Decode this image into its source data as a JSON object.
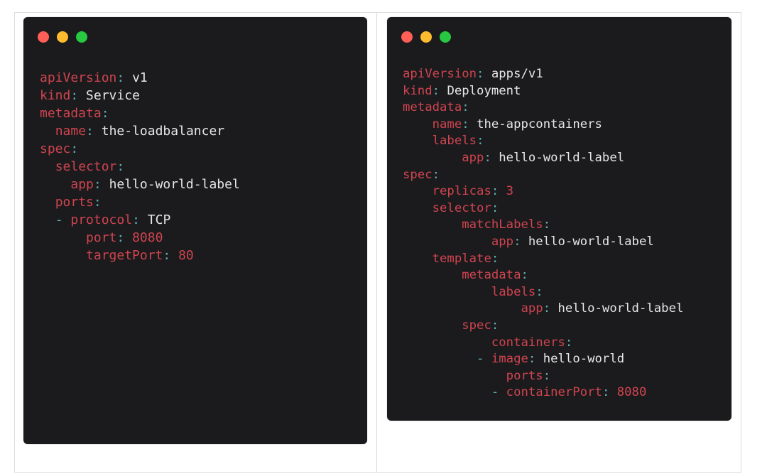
{
  "colors": {
    "key": "#cf4450",
    "punct": "#5fb3b3",
    "num": "#cf4450",
    "value": "#e6e6e6",
    "background": "#1b1b1d",
    "dot_red": "#ff5f57",
    "dot_yellow": "#febc2e",
    "dot_green": "#28c840"
  },
  "window_controls": [
    "close-dot",
    "minimize-dot",
    "maximize-dot"
  ],
  "service_yaml": [
    {
      "indent": 0,
      "key": "apiVersion",
      "value": "v1"
    },
    {
      "indent": 0,
      "key": "kind",
      "value": "Service"
    },
    {
      "indent": 0,
      "key": "metadata"
    },
    {
      "indent": 2,
      "key": "name",
      "value": "the-loadbalancer"
    },
    {
      "indent": 0,
      "key": "spec"
    },
    {
      "indent": 2,
      "key": "selector"
    },
    {
      "indent": 4,
      "key": "app",
      "value": "hello-world-label"
    },
    {
      "indent": 2,
      "key": "ports"
    },
    {
      "indent": 4,
      "dash": true,
      "key": "protocol",
      "value": "TCP"
    },
    {
      "indent": 6,
      "key": "port",
      "value": "8080",
      "numeric": true
    },
    {
      "indent": 6,
      "key": "targetPort",
      "value": "80",
      "numeric": true
    }
  ],
  "deployment_yaml": [
    {
      "indent": 0,
      "key": "apiVersion",
      "value": "apps/v1"
    },
    {
      "indent": 0,
      "key": "kind",
      "value": "Deployment"
    },
    {
      "indent": 0,
      "key": "metadata"
    },
    {
      "indent": 4,
      "key": "name",
      "value": "the-appcontainers"
    },
    {
      "indent": 4,
      "key": "labels"
    },
    {
      "indent": 8,
      "key": "app",
      "value": "hello-world-label"
    },
    {
      "indent": 0,
      "key": "spec"
    },
    {
      "indent": 4,
      "key": "replicas",
      "value": "3",
      "numeric": true
    },
    {
      "indent": 4,
      "key": "selector"
    },
    {
      "indent": 8,
      "key": "matchLabels"
    },
    {
      "indent": 12,
      "key": "app",
      "value": "hello-world-label"
    },
    {
      "indent": 4,
      "key": "template"
    },
    {
      "indent": 8,
      "key": "metadata"
    },
    {
      "indent": 12,
      "key": "labels"
    },
    {
      "indent": 16,
      "key": "app",
      "value": "hello-world-label"
    },
    {
      "indent": 8,
      "key": "spec"
    },
    {
      "indent": 12,
      "key": "containers"
    },
    {
      "indent": 12,
      "dash": true,
      "key": "image",
      "value": "hello-world"
    },
    {
      "indent": 14,
      "key": "ports"
    },
    {
      "indent": 14,
      "dash": true,
      "key": "containerPort",
      "value": "8080",
      "numeric": true
    }
  ]
}
